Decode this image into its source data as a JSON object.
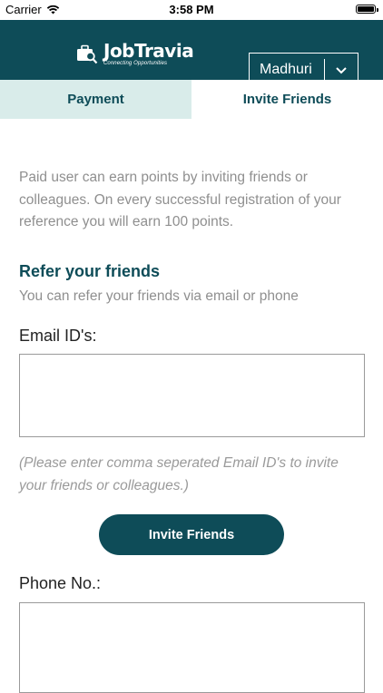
{
  "status_bar": {
    "carrier": "Carrier",
    "time": "3:58 PM"
  },
  "header": {
    "logo_text": "JobTravia",
    "logo_tagline": "Connecting Opportunities",
    "user_name": "Madhuri"
  },
  "tabs": [
    {
      "label": "Payment",
      "active": false
    },
    {
      "label": "Invite Friends",
      "active": true
    }
  ],
  "intro_text": "Paid user can earn points by inviting friends or colleagues. On every successful registration of your reference you will earn 100 points.",
  "refer": {
    "title": "Refer your friends",
    "subtitle": "You can refer your friends via email or phone"
  },
  "email": {
    "label": "Email ID's:",
    "value": "",
    "hint": "(Please enter comma seperated Email ID's to invite your friends or colleagues.)"
  },
  "invite_button_label": "Invite Friends",
  "phone": {
    "label": "Phone No.:",
    "value": ""
  },
  "colors": {
    "primary": "#0e4c58",
    "tab_inactive_bg": "#d9ecea",
    "muted_text": "#8f8f8f"
  }
}
